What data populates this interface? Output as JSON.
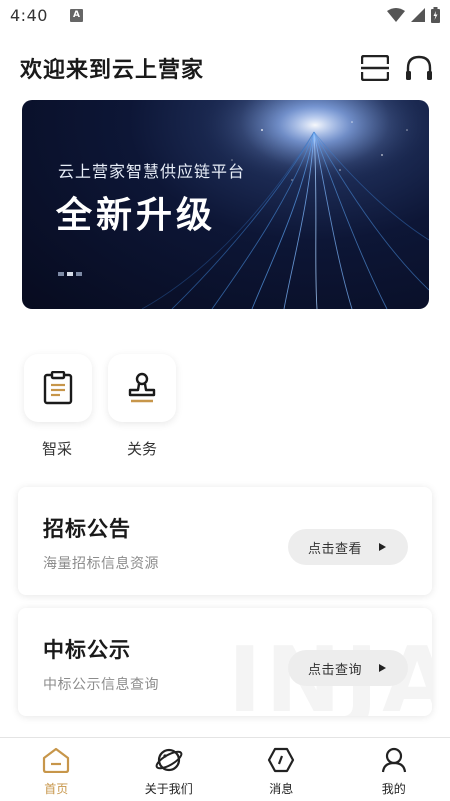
{
  "status_bar": {
    "time": "4:40",
    "notification_badge": "A"
  },
  "header": {
    "title": "欢迎来到云上营家",
    "icons": [
      "scan-icon",
      "headset-icon"
    ]
  },
  "banner": {
    "subtitle": "云上营家智慧供应链平台",
    "headline": "全新升级",
    "slide_count": 3,
    "active_slide": 2
  },
  "shortcuts": [
    {
      "label": "智采",
      "icon": "clipboard-icon"
    },
    {
      "label": "关务",
      "icon": "stamp-icon"
    }
  ],
  "cards": [
    {
      "title": "招标公告",
      "description": "海量招标信息资源",
      "button": "点击查看"
    },
    {
      "title": "中标公示",
      "description": "中标公示信息查询",
      "button": "点击查询"
    }
  ],
  "watermark_text": "INJA",
  "bottom_nav": [
    {
      "label": "首页",
      "icon": "home-icon",
      "active": true
    },
    {
      "label": "关于我们",
      "icon": "planet-icon",
      "active": false
    },
    {
      "label": "消息",
      "icon": "message-icon",
      "active": false
    },
    {
      "label": "我的",
      "icon": "user-icon",
      "active": false
    }
  ],
  "colors": {
    "accent": "#c7964a",
    "banner_bg": "#0d1636",
    "card_button_bg": "#ededed"
  }
}
